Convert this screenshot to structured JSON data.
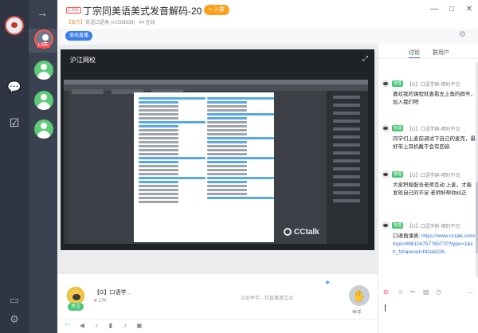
{
  "window": {
    "live_tag": "LIVE",
    "title": "丁宗同美语美式发音解码-20",
    "join_label": "+ 入群",
    "official_tag": "【官方】",
    "group_info": "英语口语角 (#1508839)",
    "online_count": "44 在线",
    "controls": [
      "—",
      "□",
      "✕"
    ]
  },
  "groups": {
    "live_badge": "LIVE"
  },
  "toolbar": {
    "exit_label": "退出直播"
  },
  "video": {
    "school_name": "沪江网校",
    "brand_watermark": "CCtalk"
  },
  "host": {
    "name": "【G】口语学...",
    "follow_label": "关注",
    "fans": "17K",
    "interact_hint": "点此举手，和直播者互动",
    "hand_label": "举手"
  },
  "chat": {
    "tabs": [
      "讨论",
      "群用户"
    ],
    "messages": [
      {
        "badge": "管理",
        "sender": "【G】口语学群-晴时不见",
        "text": "喜欢我的课程就查看左上角的群号，加入我们吧"
      },
      {
        "badge": "管理",
        "sender": "【G】口语学群-晴时不见",
        "text": "同学们上麦前调试下自己的麦克，最好带上耳机戴不会有回音"
      },
      {
        "badge": "管理",
        "sender": "【G】口语学群-晴时不见",
        "text": "大家积极配合老师互动 上麦，才能发现自己的不足 老师好帮你纠正"
      },
      {
        "badge": "管理",
        "sender": "【G】口语学群-晴时不见",
        "text_prefix": "口语角课表: ",
        "link": "https://www.cctalk.com/topic/496104757765770?type=1&xh_fshareuid=f42a6326-"
      }
    ]
  },
  "colors": {
    "accent_blue": "#3b7fe8",
    "live_red": "#ff4d4f",
    "join_orange": "#ff9f1c",
    "admin_green": "#48c774"
  }
}
